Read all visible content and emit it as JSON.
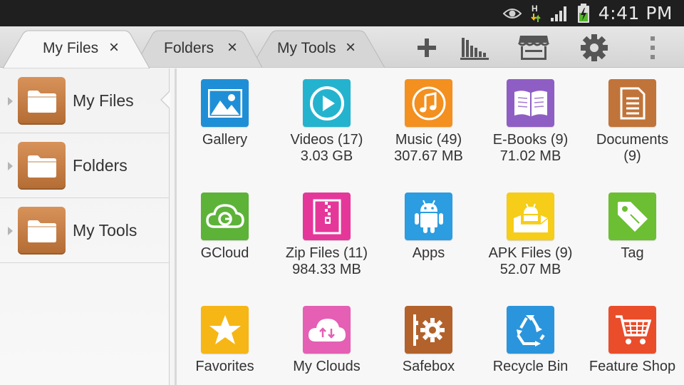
{
  "status_bar": {
    "time": "4:41 PM",
    "icons": [
      "eye-icon",
      "data-transfer-icon",
      "signal-icon",
      "battery-charging-icon"
    ],
    "data_letter": "H"
  },
  "tabs": [
    {
      "label": "My Files",
      "active": true
    },
    {
      "label": "Folders",
      "active": false
    },
    {
      "label": "My Tools",
      "active": false
    }
  ],
  "tab_close_glyph": "×",
  "toolbar": [
    "add-icon",
    "bar-chart-icon",
    "shop-icon",
    "settings-gear-icon",
    "overflow-menu-icon"
  ],
  "sidebar": {
    "items": [
      {
        "label": "My Files",
        "selected": true
      },
      {
        "label": "Folders",
        "selected": false
      },
      {
        "label": "My Tools",
        "selected": false
      }
    ]
  },
  "grid": [
    {
      "label": "Gallery",
      "sub": "",
      "icon": "gallery-icon",
      "color": "#1e8fd6"
    },
    {
      "label": "Videos (17)",
      "sub": "3.03 GB",
      "icon": "video-play-icon",
      "color": "#24b3cf"
    },
    {
      "label": "Music (49)",
      "sub": "307.67 MB",
      "icon": "music-note-icon",
      "color": "#f3901f"
    },
    {
      "label": "E-Books (9)",
      "sub": "71.02 MB",
      "icon": "book-icon",
      "color": "#8e5ec4"
    },
    {
      "label": "Documents",
      "sub": "(9)",
      "icon": "document-icon",
      "color": "#c0743a"
    },
    {
      "label": "GCloud",
      "sub": "",
      "icon": "gcloud-icon",
      "color": "#5cb338"
    },
    {
      "label": "Zip Files (11)",
      "sub": "984.33 MB",
      "icon": "zip-icon",
      "color": "#e5379a"
    },
    {
      "label": "Apps",
      "sub": "",
      "icon": "android-icon",
      "color": "#2b9de0"
    },
    {
      "label": "APK Files (9)",
      "sub": "52.07 MB",
      "icon": "apk-box-icon",
      "color": "#f6cd18"
    },
    {
      "label": "Tag",
      "sub": "",
      "icon": "tag-icon",
      "color": "#6cbf32"
    },
    {
      "label": "Favorites",
      "sub": "",
      "icon": "star-icon",
      "color": "#f6b615"
    },
    {
      "label": "My Clouds",
      "sub": "",
      "icon": "cloud-sync-icon",
      "color": "#e55fb4"
    },
    {
      "label": "Safebox",
      "sub": "",
      "icon": "safe-icon",
      "color": "#b2622a"
    },
    {
      "label": "Recycle Bin",
      "sub": "",
      "icon": "recycle-icon",
      "color": "#2a95dc"
    },
    {
      "label": "Feature Shop",
      "sub": "",
      "icon": "cart-icon",
      "color": "#ea4d2a"
    }
  ]
}
